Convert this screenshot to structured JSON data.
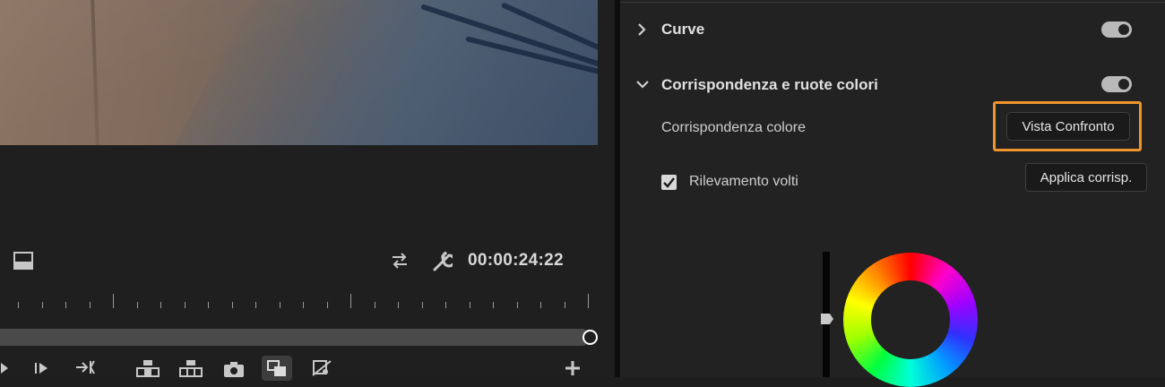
{
  "monitor": {
    "timecode": "00:00:24:22",
    "icons": {
      "safe_margins": "safe-margins-icon",
      "loop": "loop-icon",
      "settings": "wrench-icon",
      "step_back": "step-back-icon",
      "step_forward": "step-forward-icon",
      "go_to_out": "go-to-out-icon",
      "lift": "lift-icon",
      "extract": "extract-icon",
      "export_frame": "camera-icon",
      "comparison_view": "comparison-view-icon",
      "proxy": "proxy-icon",
      "add": "plus-icon"
    }
  },
  "panel": {
    "sections": [
      {
        "title": "Curve",
        "expanded": false,
        "enabled": true
      },
      {
        "title": "Corrispondenza e ruote colori",
        "expanded": true,
        "enabled": true
      }
    ],
    "color_match_label": "Corrispondenza colore",
    "comparison_button": "Vista Confronto",
    "face_detection_label": "Rilevamento volti",
    "face_detection_checked": true,
    "apply_match_button": "Applica corrisp."
  },
  "colors": {
    "highlight": "#f0942c",
    "panel_bg": "#222222",
    "monitor_bg": "#1f1f1f"
  }
}
